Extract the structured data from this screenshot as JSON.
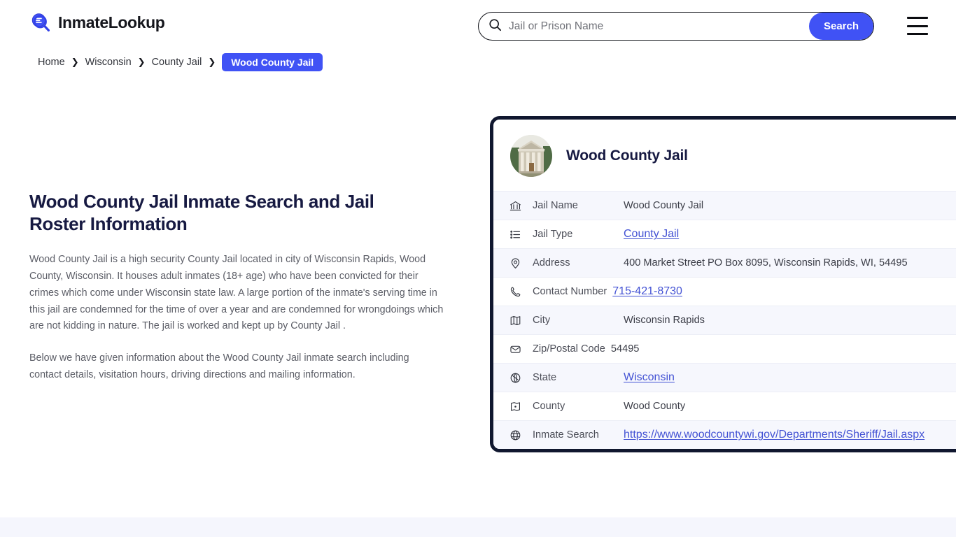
{
  "header": {
    "brand_name": "InmateLookup",
    "logo_icon": "inmate-lookup-search-logo",
    "search": {
      "placeholder": "Jail or Prison Name",
      "value": "",
      "icon": "search-icon",
      "button_label": "Search"
    },
    "menu_icon": "hamburger-menu-icon",
    "accent_color": "#4052f5"
  },
  "breadcrumb": {
    "items": [
      {
        "label": "Home",
        "current": false
      },
      {
        "label": "Wisconsin",
        "current": false
      },
      {
        "label": "County Jail",
        "current": false
      },
      {
        "label": "Wood County Jail",
        "current": true
      }
    ],
    "separator_icon": "chevron-right-icon"
  },
  "main": {
    "title": "Wood County Jail Inmate Search and Jail Roster Information",
    "paragraph_1": "Wood County Jail is a high security County Jail located in city of Wisconsin Rapids, Wood County, Wisconsin. It houses adult inmates (18+ age) who have been convicted for their crimes which come under Wisconsin state law. A large portion of the inmate's serving time in this jail are condemned for the time of over a year and are condemned for wrongdoings which are not kidding in nature. The jail is worked and kept up by County Jail .",
    "paragraph_2": "Below we have given information about the Wood County Jail inmate search including contact details, visitation hours, driving directions and mailing information."
  },
  "card": {
    "avatar_icon": "courthouse-building-photo",
    "title": "Wood County Jail",
    "border_color": "#10172f",
    "rows": [
      {
        "icon": "bank-building-icon",
        "label": "Jail Name",
        "value": "Wood County Jail",
        "is_link": false
      },
      {
        "icon": "list-icon",
        "label": "Jail Type",
        "value": "County Jail",
        "is_link": true
      },
      {
        "icon": "map-pin-icon",
        "label": "Address",
        "value": "400 Market Street PO Box 8095, Wisconsin Rapids, WI, 54495",
        "is_link": false
      },
      {
        "icon": "phone-icon",
        "label": "Contact Number",
        "value": "715-421-8730",
        "is_link": true
      },
      {
        "icon": "map-icon",
        "label": "City",
        "value": "Wisconsin Rapids",
        "is_link": false
      },
      {
        "icon": "envelope-icon",
        "label": "Zip/Postal Code",
        "value": "54495",
        "is_link": false
      },
      {
        "icon": "globe-icon",
        "label": "State",
        "value": "Wisconsin",
        "is_link": true
      },
      {
        "icon": "county-region-icon",
        "label": "County",
        "value": "Wood County",
        "is_link": false
      },
      {
        "icon": "globe-grid-icon",
        "label": "Inmate Search",
        "value": "https://www.woodcountywi.gov/Departments/Sheriff/Jail.aspx",
        "is_link": true
      }
    ]
  }
}
